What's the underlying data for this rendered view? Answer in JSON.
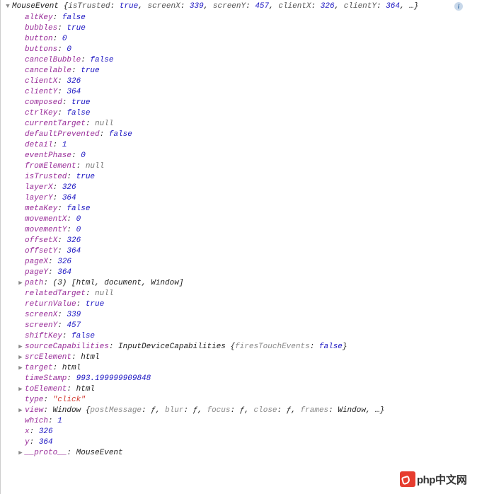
{
  "summary": {
    "className": "MouseEvent",
    "previewPairs": [
      {
        "k": "isTrusted",
        "v": "true",
        "t": "bool"
      },
      {
        "k": "screenX",
        "v": "339",
        "t": "num"
      },
      {
        "k": "screenY",
        "v": "457",
        "t": "num"
      },
      {
        "k": "clientX",
        "v": "326",
        "t": "num"
      },
      {
        "k": "clientY",
        "v": "364",
        "t": "num"
      }
    ],
    "ellipsis": "…"
  },
  "props": [
    {
      "key": "altKey",
      "value": "false",
      "type": "bool",
      "arrow": ""
    },
    {
      "key": "bubbles",
      "value": "true",
      "type": "bool",
      "arrow": ""
    },
    {
      "key": "button",
      "value": "0",
      "type": "num",
      "arrow": ""
    },
    {
      "key": "buttons",
      "value": "0",
      "type": "num",
      "arrow": ""
    },
    {
      "key": "cancelBubble",
      "value": "false",
      "type": "bool",
      "arrow": ""
    },
    {
      "key": "cancelable",
      "value": "true",
      "type": "bool",
      "arrow": ""
    },
    {
      "key": "clientX",
      "value": "326",
      "type": "num",
      "arrow": ""
    },
    {
      "key": "clientY",
      "value": "364",
      "type": "num",
      "arrow": ""
    },
    {
      "key": "composed",
      "value": "true",
      "type": "bool",
      "arrow": ""
    },
    {
      "key": "ctrlKey",
      "value": "false",
      "type": "bool",
      "arrow": ""
    },
    {
      "key": "currentTarget",
      "value": "null",
      "type": "null",
      "arrow": ""
    },
    {
      "key": "defaultPrevented",
      "value": "false",
      "type": "bool",
      "arrow": ""
    },
    {
      "key": "detail",
      "value": "1",
      "type": "num",
      "arrow": ""
    },
    {
      "key": "eventPhase",
      "value": "0",
      "type": "num",
      "arrow": ""
    },
    {
      "key": "fromElement",
      "value": "null",
      "type": "null",
      "arrow": ""
    },
    {
      "key": "isTrusted",
      "value": "true",
      "type": "bool",
      "arrow": ""
    },
    {
      "key": "layerX",
      "value": "326",
      "type": "num",
      "arrow": ""
    },
    {
      "key": "layerY",
      "value": "364",
      "type": "num",
      "arrow": ""
    },
    {
      "key": "metaKey",
      "value": "false",
      "type": "bool",
      "arrow": ""
    },
    {
      "key": "movementX",
      "value": "0",
      "type": "num",
      "arrow": ""
    },
    {
      "key": "movementY",
      "value": "0",
      "type": "num",
      "arrow": ""
    },
    {
      "key": "offsetX",
      "value": "326",
      "type": "num",
      "arrow": ""
    },
    {
      "key": "offsetY",
      "value": "364",
      "type": "num",
      "arrow": ""
    },
    {
      "key": "pageX",
      "value": "326",
      "type": "num",
      "arrow": ""
    },
    {
      "key": "pageY",
      "value": "364",
      "type": "num",
      "arrow": ""
    },
    {
      "key": "path",
      "value": "(3) [html, document, Window]",
      "type": "obj",
      "arrow": "▶"
    },
    {
      "key": "relatedTarget",
      "value": "null",
      "type": "null",
      "arrow": ""
    },
    {
      "key": "returnValue",
      "value": "true",
      "type": "bool",
      "arrow": ""
    },
    {
      "key": "screenX",
      "value": "339",
      "type": "num",
      "arrow": ""
    },
    {
      "key": "screenY",
      "value": "457",
      "type": "num",
      "arrow": ""
    },
    {
      "key": "shiftKey",
      "value": "false",
      "type": "bool",
      "arrow": ""
    },
    {
      "key": "sourceCapabilities",
      "value": "InputDeviceCapabilities {firesTouchEvents: false}",
      "type": "obj",
      "arrow": "▶"
    },
    {
      "key": "srcElement",
      "value": "html",
      "type": "obj",
      "arrow": "▶"
    },
    {
      "key": "target",
      "value": "html",
      "type": "obj",
      "arrow": "▶"
    },
    {
      "key": "timeStamp",
      "value": "993.199999909848",
      "type": "num",
      "arrow": ""
    },
    {
      "key": "toElement",
      "value": "html",
      "type": "obj",
      "arrow": "▶"
    },
    {
      "key": "type",
      "value": "\"click\"",
      "type": "str",
      "arrow": ""
    },
    {
      "key": "view",
      "value": "Window {postMessage: ƒ, blur: ƒ, focus: ƒ, close: ƒ, frames: Window, …}",
      "type": "obj",
      "arrow": "▶"
    },
    {
      "key": "which",
      "value": "1",
      "type": "num",
      "arrow": ""
    },
    {
      "key": "x",
      "value": "326",
      "type": "num",
      "arrow": ""
    },
    {
      "key": "y",
      "value": "364",
      "type": "num",
      "arrow": ""
    },
    {
      "key": "__proto__",
      "value": "MouseEvent",
      "type": "obj",
      "arrow": "▶"
    }
  ],
  "watermark": {
    "php": "php",
    "cn": "中文网"
  }
}
